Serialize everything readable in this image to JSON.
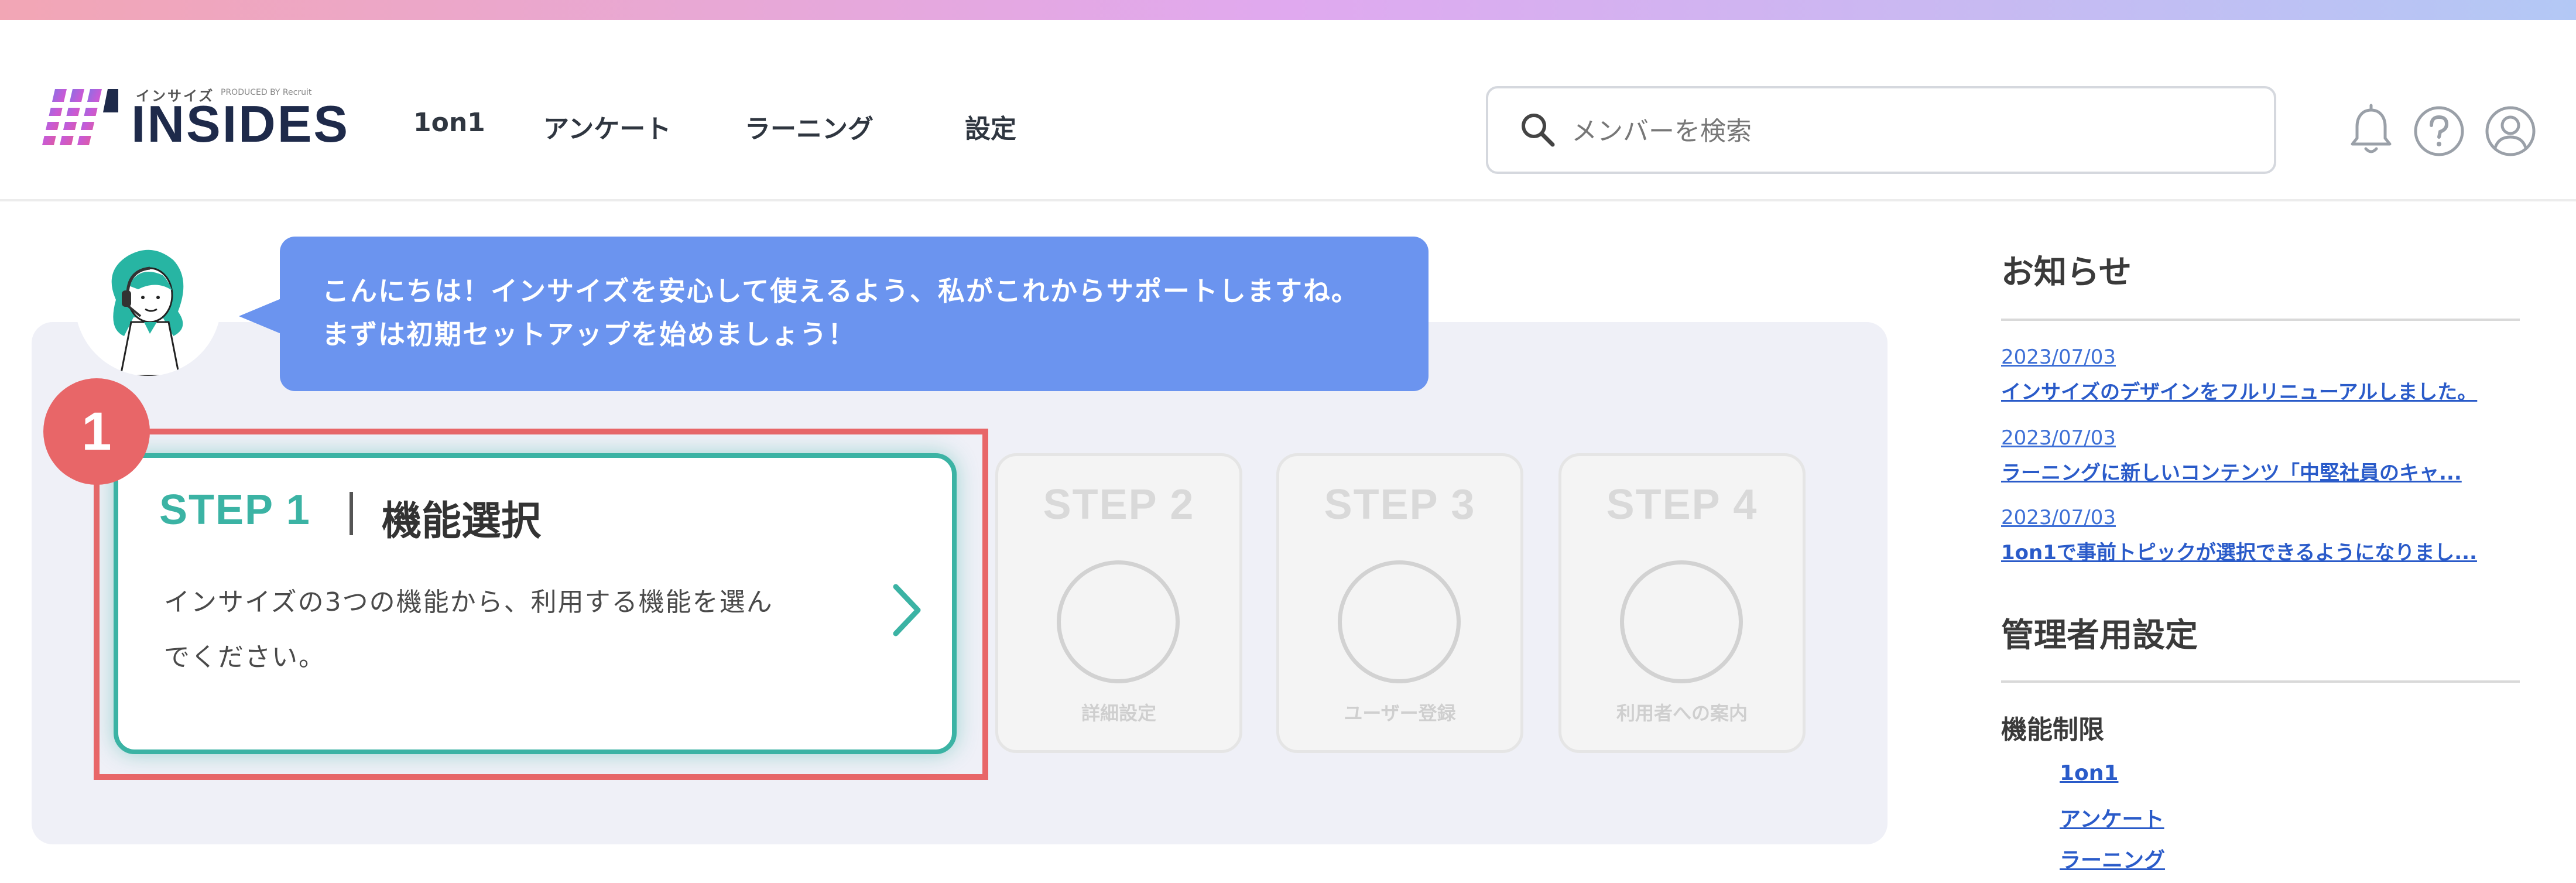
{
  "header": {
    "logo_small": "インサイズ",
    "logo_producer": "PRODUCED BY Recruit",
    "logo_text": "INSIDES",
    "nav": [
      "1on1",
      "アンケート",
      "ラーニング",
      "設定"
    ],
    "search_placeholder": "メンバーを検索",
    "icons": [
      "bell-icon",
      "help-icon",
      "user-icon"
    ]
  },
  "guide": {
    "bubble_line1": "こんにちは！インサイズを安心して使えるよう、私がこれからサポートしますね。",
    "bubble_line2": "まずは初期セットアップを始めましょう！",
    "badge": "1"
  },
  "steps": {
    "active": {
      "title": "STEP 1",
      "name": "機能選択",
      "desc_line1": "インサイズの3つの機能から、利用する機能を選ん",
      "desc_line2": "でください。"
    },
    "inactive": [
      {
        "title": "STEP 2",
        "label": "詳細設定"
      },
      {
        "title": "STEP 3",
        "label": "ユーザー登録"
      },
      {
        "title": "STEP 4",
        "label": "利用者への案内"
      }
    ]
  },
  "sidebar": {
    "news_heading": "お知らせ",
    "news": [
      {
        "date": "2023/07/03",
        "title": "インサイズのデザインをフルリニューアルしました。"
      },
      {
        "date": "2023/07/03",
        "title": "ラーニングに新しいコンテンツ「中堅社員のキャ..."
      },
      {
        "date": "2023/07/03",
        "title": "1on1で事前トピックが選択できるようになりまし..."
      }
    ],
    "admin_heading": "管理者用設定",
    "restriction_heading": "機能制限",
    "restriction_links": [
      "1on1",
      "アンケート",
      "ラーニング"
    ]
  },
  "colors": {
    "accent_teal": "#3bb3a4",
    "bubble_blue": "#6b94ef",
    "highlight_red": "#e86668",
    "link_blue": "#2a5bc9"
  }
}
